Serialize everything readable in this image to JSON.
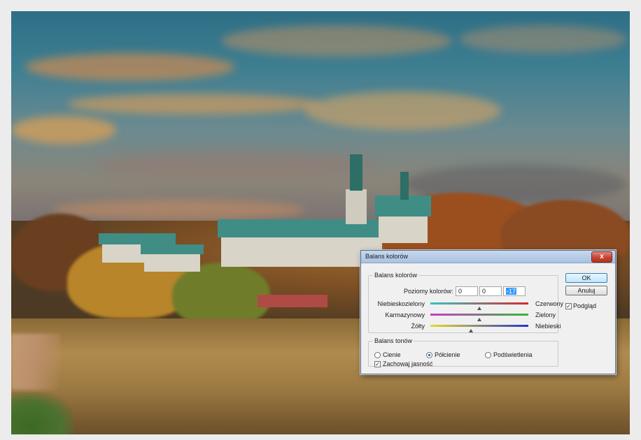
{
  "dialog": {
    "title": "Balans kolorów",
    "close_label": "x",
    "color_balance": {
      "legend": "Balans kolorów",
      "levels_label": "Poziomy kolorów:",
      "levels": [
        "0",
        "0",
        "-17"
      ],
      "sliders": [
        {
          "left": "Niebieskozielony",
          "right": "Czerwony",
          "value": 0,
          "left_color": "#36c3c3",
          "right_color": "#d9262a"
        },
        {
          "left": "Karmazynowy",
          "right": "Zielony",
          "value": 0,
          "left_color": "#c83cc8",
          "right_color": "#36b836"
        },
        {
          "left": "Żółty",
          "right": "Niebieski",
          "value": -17,
          "left_color": "#e6dc2a",
          "right_color": "#2a35c8"
        }
      ]
    },
    "tone_balance": {
      "legend": "Balans tonów",
      "options": [
        "Cienie",
        "Półcienie",
        "Podświetlenia"
      ],
      "selected": "Półcienie",
      "preserve_label": "Zachowaj jasność",
      "preserve_checked": true
    },
    "buttons": {
      "ok": "OK",
      "cancel": "Anuluj"
    },
    "preview_label": "Podgląd",
    "preview_checked": true
  }
}
